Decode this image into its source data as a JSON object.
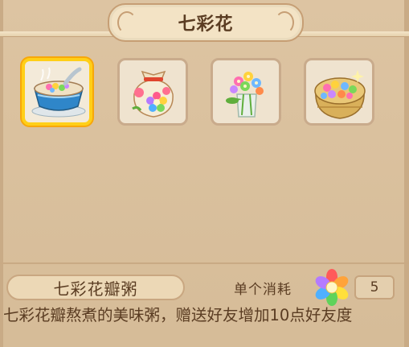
{
  "title": "七彩花",
  "items": [
    {
      "name": "porridge-bowl",
      "selected": true
    },
    {
      "name": "flower-sack",
      "selected": false
    },
    {
      "name": "flower-vase",
      "selected": false
    },
    {
      "name": "flower-basket",
      "selected": false
    }
  ],
  "selected_item": {
    "name": "七彩花瓣粥",
    "cost_label": "单个消耗",
    "cost_value": "5",
    "description": "七彩花瓣熬煮的美味粥，赠送好友增加10点好友度"
  },
  "colors": {
    "background": "#d9bf9c",
    "text": "#5a3c22",
    "selected_border": "#ffcf18",
    "slot_border": "#c9ab8c"
  }
}
